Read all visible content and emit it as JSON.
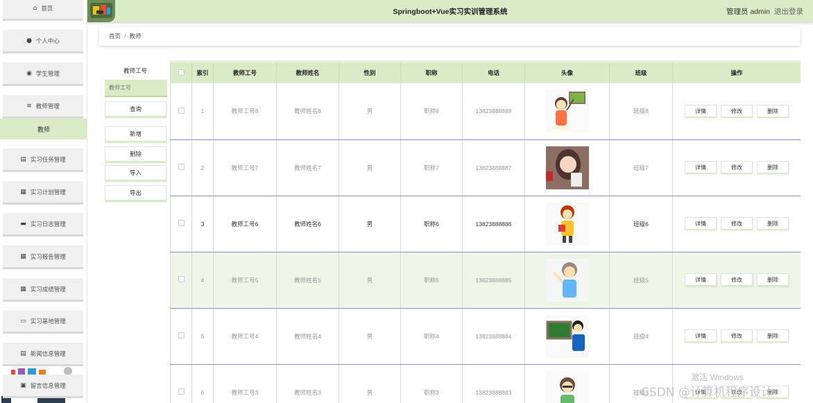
{
  "header": {
    "title": "Springboot+Vue实习实训管理系统",
    "user": "管理员 admin",
    "logout": "退出登录"
  },
  "sidebar": {
    "items": [
      {
        "label": "首页",
        "icon": "home-icon"
      },
      {
        "label": "个人中心",
        "icon": "user-icon"
      },
      {
        "label": "学生管理",
        "icon": "location-icon"
      },
      {
        "label": "教师管理",
        "icon": "list-icon"
      },
      {
        "label": "实习任务管理",
        "icon": "document-icon"
      },
      {
        "label": "实习计划管理",
        "icon": "grid-icon"
      },
      {
        "label": "实习日志管理",
        "icon": "log-icon"
      },
      {
        "label": "实习报告管理",
        "icon": "grid-icon"
      },
      {
        "label": "实习成绩管理",
        "icon": "grid-icon"
      },
      {
        "label": "实习基地管理",
        "icon": "monitor-icon"
      },
      {
        "label": "新闻信息管理",
        "icon": "news-icon"
      },
      {
        "label": "留言信息管理",
        "icon": "message-icon"
      }
    ],
    "active_sub": "教师"
  },
  "breadcrumb": {
    "home": "首页",
    "separator": "/",
    "current": "教师"
  },
  "search": {
    "label": "教师工号",
    "placeholder": "教师工号",
    "query_button": "查询"
  },
  "actions": {
    "add": "新增",
    "delete": "删除",
    "import": "导入",
    "export": "导出"
  },
  "table": {
    "headers": [
      "索引",
      "教师工号",
      "教师姓名",
      "性别",
      "职称",
      "电话",
      "头像",
      "班级",
      "操作"
    ],
    "row_buttons": {
      "detail": "详情",
      "edit": "修改",
      "delete": "删除"
    },
    "rows": [
      {
        "index": "1",
        "id": "教师工号8",
        "name": "教师姓名8",
        "gender": "男",
        "title": "职称8",
        "phone": "13823888888",
        "class": "班级8",
        "avatar": "teacher-pointing-board-icon"
      },
      {
        "index": "2",
        "id": "教师工号7",
        "name": "教师姓名7",
        "gender": "男",
        "title": "职称7",
        "phone": "13823888887",
        "class": "班级7",
        "avatar": "woman-reading-icon"
      },
      {
        "index": "3",
        "id": "教师工号6",
        "name": "教师姓名6",
        "gender": "男",
        "title": "职称6",
        "phone": "13823888886",
        "class": "班级6",
        "avatar": "teacher-with-book-icon"
      },
      {
        "index": "4",
        "id": "教师工号5",
        "name": "教师姓名5",
        "gender": "男",
        "title": "职称5",
        "phone": "13823888885",
        "class": "班级5",
        "avatar": "teacher-waving-icon"
      },
      {
        "index": "5",
        "id": "教师工号4",
        "name": "教师姓名4",
        "gender": "男",
        "title": "职称4",
        "phone": "13823888884",
        "class": "班级4",
        "avatar": "teacher-chalkboard-icon"
      },
      {
        "index": "6",
        "id": "教师工号3",
        "name": "教师姓名3",
        "gender": "男",
        "title": "职称3",
        "phone": "13823888883",
        "class": "班级3",
        "avatar": "teacher-glasses-icon"
      }
    ]
  },
  "watermark": {
    "activate": "激活 Windows",
    "csdn": "CSDN @计算机程序设计"
  },
  "colors": {
    "accent": "#d9ecc7",
    "row_highlight": "#eef6e7",
    "row_border": "#8f8fc2"
  }
}
